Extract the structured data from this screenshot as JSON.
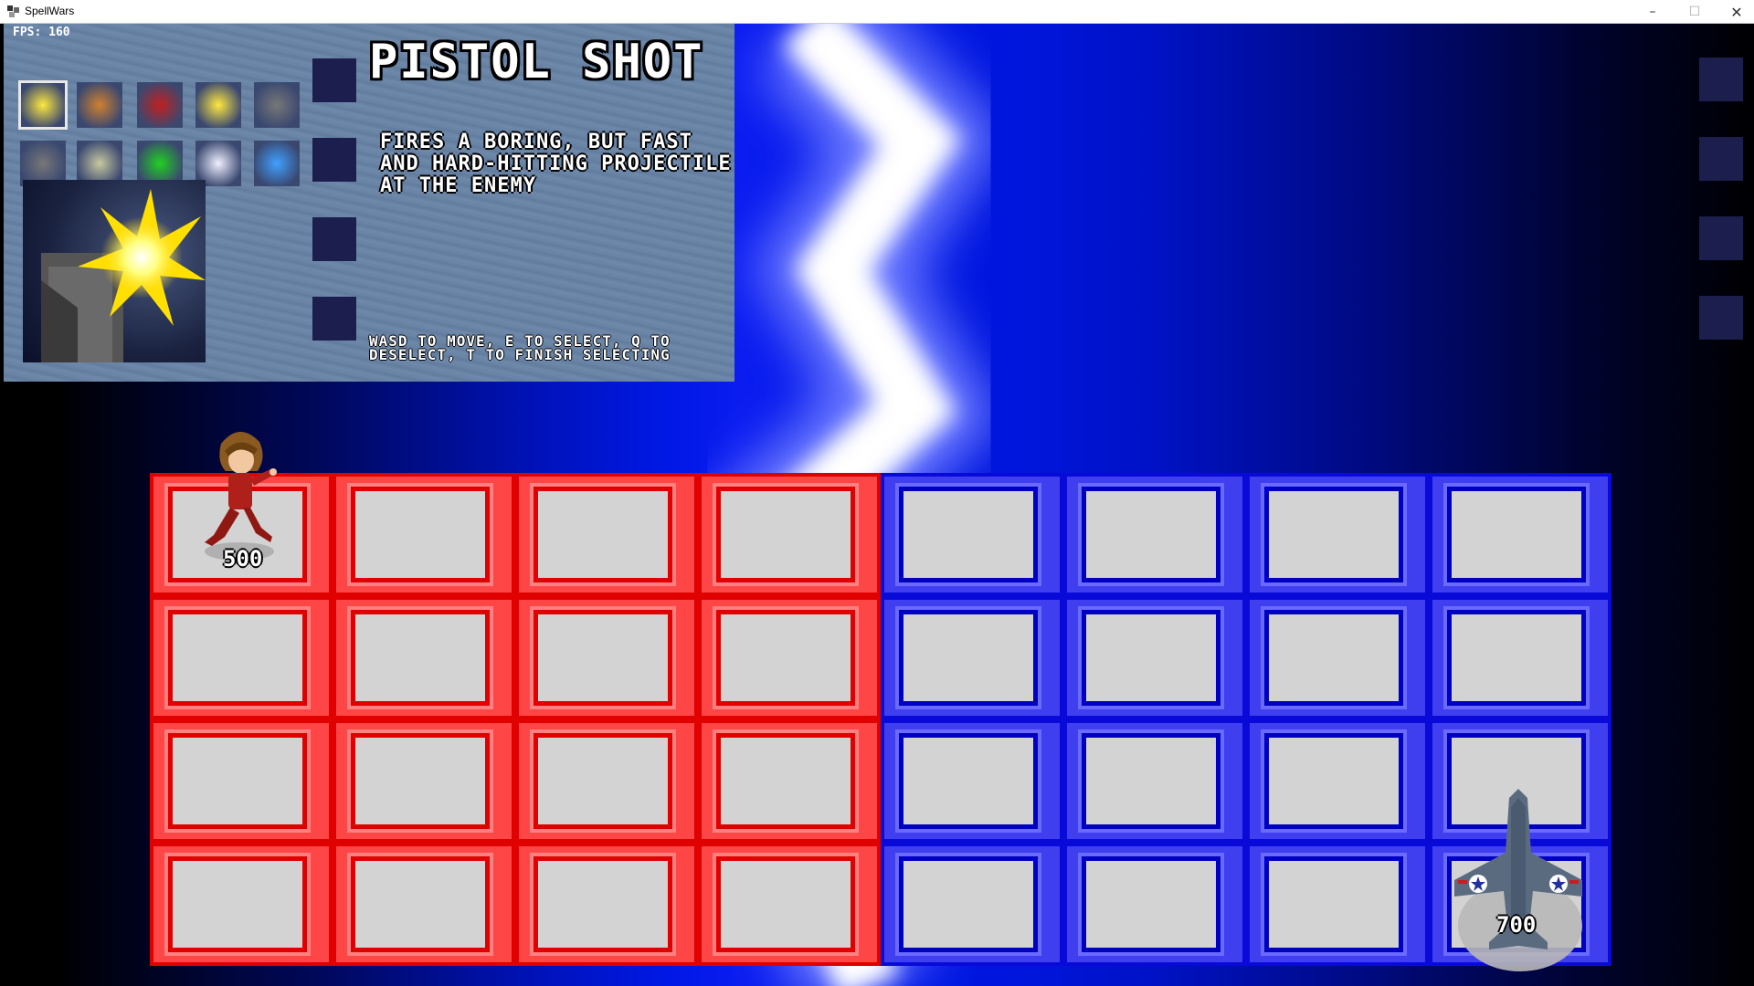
{
  "window": {
    "title": "SpellWars",
    "minimize": "–",
    "maximize": "☐",
    "close": "✕"
  },
  "hud": {
    "fps": "FPS: 160"
  },
  "selection": {
    "chips": [
      {
        "name": "pistol-shot",
        "color": "#ffe840",
        "selected": true
      },
      {
        "name": "gatling",
        "color": "#d08030",
        "selected": false
      },
      {
        "name": "rocket",
        "color": "#c02020",
        "selected": false
      },
      {
        "name": "star",
        "color": "#ffe840",
        "selected": false
      },
      {
        "name": "cannon",
        "color": "#777777",
        "selected": false
      },
      {
        "name": "cannon",
        "color": "#777777",
        "selected": false
      },
      {
        "name": "lightning",
        "color": "#c8c8a0",
        "selected": false
      },
      {
        "name": "heal",
        "color": "#20d020",
        "selected": false
      },
      {
        "name": "swirl",
        "color": "#f0f0ff",
        "selected": false
      },
      {
        "name": "ice-burst",
        "color": "#40a0ff",
        "selected": false
      }
    ],
    "chip_name": "PISTOL SHOT",
    "chip_description": "FIRES A BORING, BUT FAST AND HARD-HITTING PROJECTILE AT THE ENEMY",
    "controls_prefix": "WASD",
    "controls_text": " TO MOVE, ",
    "controls_e": "E",
    "controls_text2": " TO SELECT, ",
    "controls_q": "Q",
    "controls_text3": " TO DESELECT, ",
    "controls_t": "T",
    "controls_text4": " TO FINISH SELECTING"
  },
  "battlefield": {
    "rows": 4,
    "cols": 8,
    "player_side_color": "#ff4646",
    "enemy_side_color": "#3f3ff0",
    "player": {
      "hp": "500",
      "row": 0,
      "col": 0
    },
    "enemy": {
      "hp": "700",
      "row": 3,
      "col": 7
    }
  }
}
